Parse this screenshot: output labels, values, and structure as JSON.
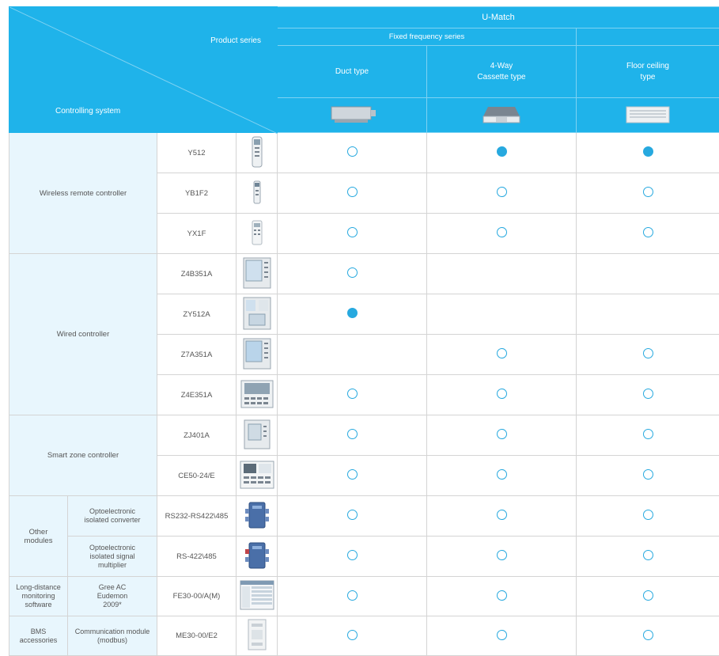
{
  "header": {
    "product_series": "Product series",
    "controlling_system": "Controlling system",
    "u_match": "U-Match",
    "fixed_frequency": "Fixed frequency series",
    "col1": "Duct type",
    "col2": "4-Way Cassette type",
    "col3": "Floor ceiling type",
    "col1_icon": "duct-unit-icon",
    "col2_icon": "cassette-unit-icon",
    "col3_icon": "floor-ceiling-unit-icon"
  },
  "categories": {
    "wireless": "Wireless remote controller",
    "wired": "Wired controller",
    "smart": "Smart zone controller",
    "other": "Other modules",
    "longdist": "Long-distance monitoring software",
    "bms": "BMS accessories"
  },
  "subcategories": {
    "opto_conv": "Optoelectronic isolated converter",
    "opto_mult": "Optoelectronic isolated signal multiplier",
    "gree": "Gree AC Eudemon 2009*",
    "comm": "Communication module (modbus)"
  },
  "rows": [
    {
      "model": "Y512",
      "icon": "remote-controller-icon",
      "duct": "open",
      "cassette": "filled",
      "floor": "filled"
    },
    {
      "model": "YB1F2",
      "icon": "remote-controller-icon",
      "duct": "open",
      "cassette": "open",
      "floor": "open"
    },
    {
      "model": "YX1F",
      "icon": "remote-controller-icon",
      "duct": "open",
      "cassette": "open",
      "floor": "open"
    },
    {
      "model": "Z4B351A",
      "icon": "wired-controller-icon",
      "duct": "open",
      "cassette": "",
      "floor": ""
    },
    {
      "model": "ZY512A",
      "icon": "wired-controller-icon",
      "duct": "filled",
      "cassette": "",
      "floor": ""
    },
    {
      "model": "Z7A351A",
      "icon": "wired-controller-icon",
      "duct": "",
      "cassette": "open",
      "floor": "open"
    },
    {
      "model": "Z4E351A",
      "icon": "wired-controller-icon",
      "duct": "open",
      "cassette": "open",
      "floor": "open"
    },
    {
      "model": "ZJ401A",
      "icon": "zone-controller-icon",
      "duct": "open",
      "cassette": "open",
      "floor": "open"
    },
    {
      "model": "CE50-24/E",
      "icon": "zone-controller-icon",
      "duct": "open",
      "cassette": "open",
      "floor": "open"
    },
    {
      "model": "RS232-RS422\\485",
      "icon": "converter-module-icon",
      "duct": "open",
      "cassette": "open",
      "floor": "open"
    },
    {
      "model": "RS-422\\485",
      "icon": "converter-module-icon",
      "duct": "open",
      "cassette": "open",
      "floor": "open"
    },
    {
      "model": "FE30-00/A(M)",
      "icon": "software-screen-icon",
      "duct": "open",
      "cassette": "open",
      "floor": "open"
    },
    {
      "model": "ME30-00/E2",
      "icon": "modbus-module-icon",
      "duct": "open",
      "cassette": "open",
      "floor": "open"
    }
  ],
  "colors": {
    "accent": "#1fb3ea",
    "mark": "#27a9df",
    "category_bg": "#e8f6fd"
  }
}
